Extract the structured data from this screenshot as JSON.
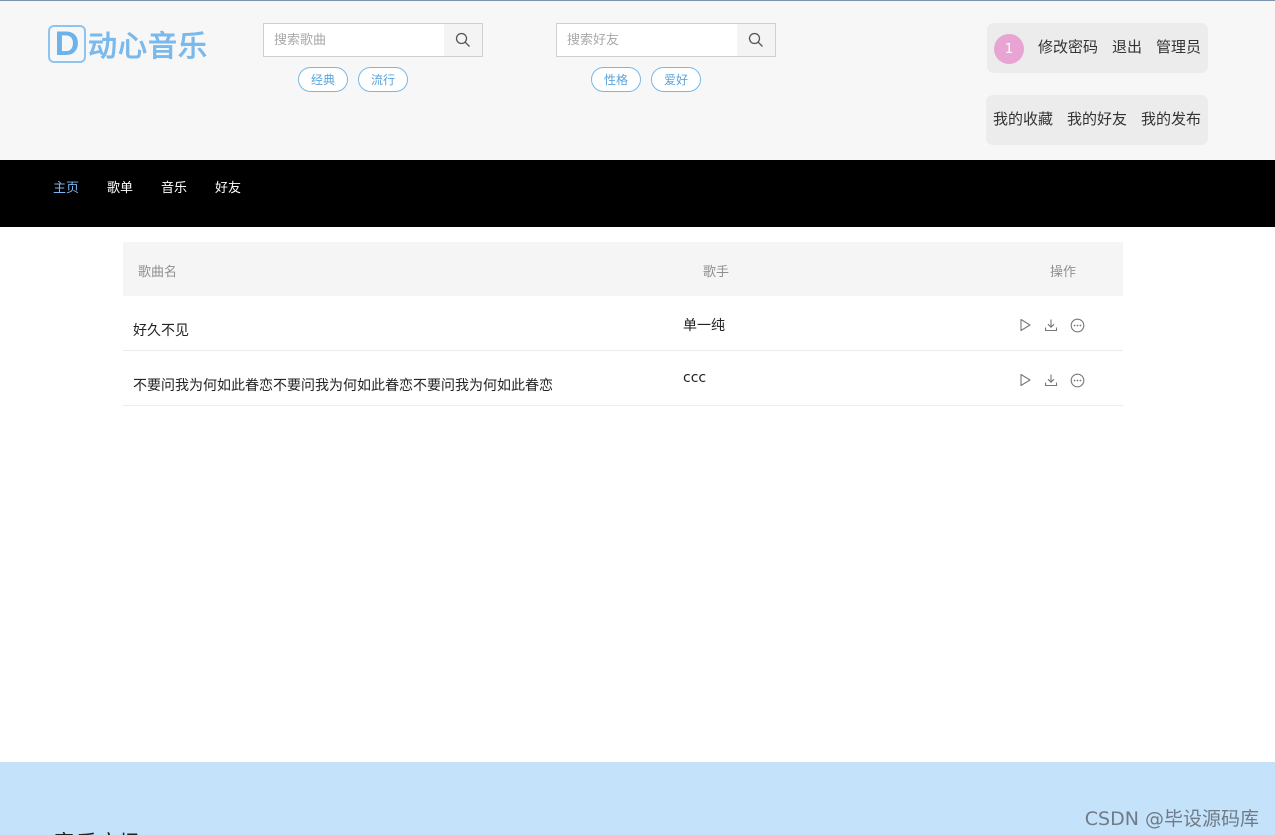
{
  "header": {
    "logo": {
      "letter": "D",
      "text": "动心音乐"
    },
    "song_search": {
      "placeholder": "搜索歌曲",
      "value": ""
    },
    "song_tags": [
      "经典",
      "流行"
    ],
    "friend_search": {
      "placeholder": "搜索好友",
      "value": ""
    },
    "friend_tags": [
      "性格",
      "爱好"
    ],
    "user": {
      "avatar_text": "1",
      "links": [
        "修改密码",
        "退出",
        "管理员"
      ]
    },
    "my_links": [
      "我的收藏",
      "我的好友",
      "我的发布"
    ]
  },
  "nav": {
    "items": [
      "主页",
      "歌单",
      "音乐",
      "好友"
    ],
    "active": "主页"
  },
  "table": {
    "columns": [
      "歌曲名",
      "歌手",
      "操作"
    ],
    "rows": [
      {
        "song": "好久不见",
        "singer": "单一纯"
      },
      {
        "song": "不要问我为何如此眷恋不要问我为何如此眷恋不要问我为何如此眷恋",
        "singer": "ccc"
      }
    ],
    "row_icons": [
      "play-icon",
      "download-icon",
      "more-icon"
    ]
  },
  "footer": {
    "title": "音乐广场",
    "watermark": "CSDN @毕设源码库"
  },
  "colors": {
    "accent": "#7bb6ec",
    "nav_bg": "#000000",
    "footer_bg": "#c5e2fb",
    "tag_border": "#79b8e6",
    "avatar_bg": "#e8a4d2"
  }
}
